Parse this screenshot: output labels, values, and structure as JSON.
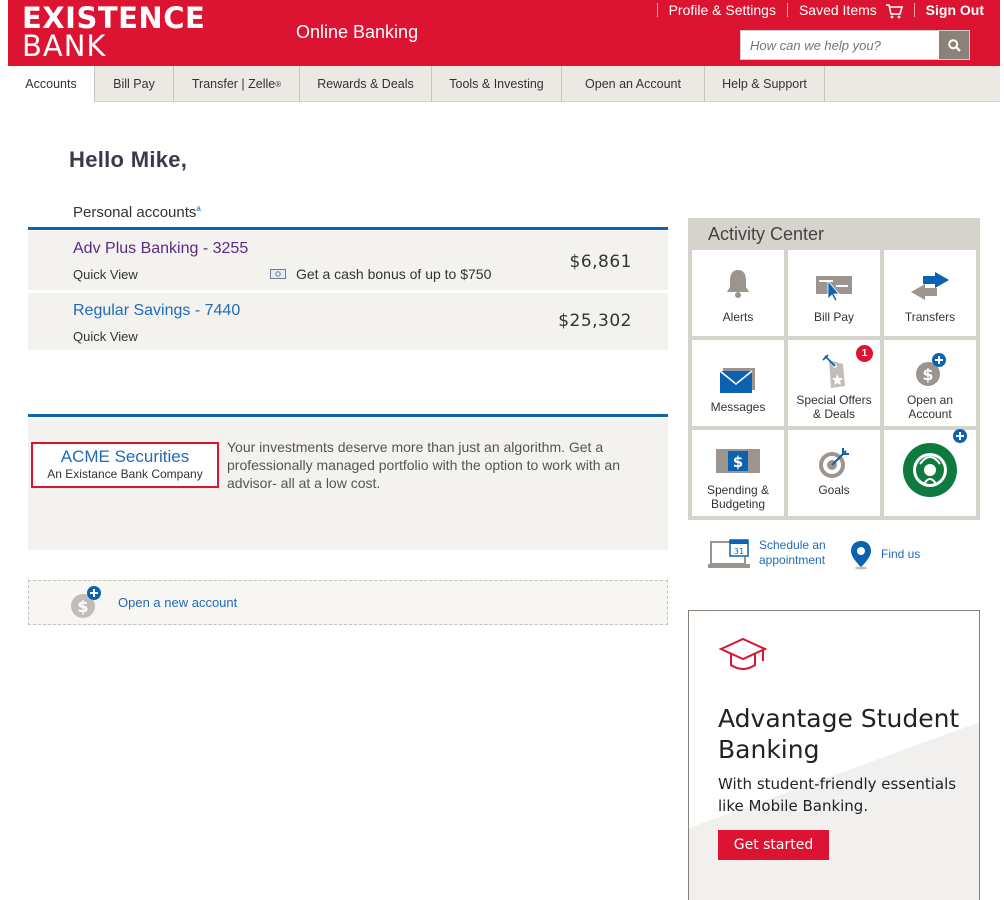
{
  "brand": {
    "line1": "EXISTENCE",
    "line2": "BANK",
    "section": "Online Banking"
  },
  "toplinks": {
    "profile": "Profile & Settings",
    "saved": "Saved Items",
    "signout": "Sign Out"
  },
  "search": {
    "placeholder": "How can we help you?"
  },
  "nav": {
    "tabs": [
      {
        "label": "Accounts"
      },
      {
        "label": "Bill Pay"
      },
      {
        "label": "Transfer | Zelle",
        "sup": "®"
      },
      {
        "label": "Rewards & Deals"
      },
      {
        "label": "Tools & Investing"
      },
      {
        "label": "Open an Account"
      },
      {
        "label": "Help & Support"
      }
    ]
  },
  "greeting": "Hello Mike,",
  "accounts": {
    "heading": "Personal accounts",
    "heading_sup": "a",
    "items": [
      {
        "name": "Adv Plus Banking - 3255",
        "quick_view": "Quick View",
        "balance": "$6,861",
        "promo": "Get a cash bonus of up to $750"
      },
      {
        "name": "Regular Savings - 7440",
        "quick_view": "Quick View",
        "balance": "$25,302"
      }
    ]
  },
  "securities": {
    "logo_title": "ACME Securities",
    "logo_sub": "An Existance Bank Company",
    "text": "Your investments deserve more than just an algorithm. Get a professionally managed portfolio with the option to work with an advisor- all at a low cost."
  },
  "open_new": {
    "label": "Open a new account"
  },
  "activity_center": {
    "title": "Activity Center",
    "tiles": [
      {
        "line1": "Alerts"
      },
      {
        "line1": "Bill Pay"
      },
      {
        "line1": "Transfers"
      },
      {
        "line1": "Messages"
      },
      {
        "line1": "Special Offers",
        "line2": "& Deals",
        "badge": "1"
      },
      {
        "line1": "Open an",
        "line2": "Account"
      },
      {
        "line1": "Spending &",
        "line2": "Budgeting"
      },
      {
        "line1": "Goals"
      }
    ]
  },
  "schedule": {
    "line1": "Schedule an",
    "line2": "appointment",
    "cal_day": "31"
  },
  "find_us": {
    "label": "Find us"
  },
  "ad": {
    "title1": "Advantage Student",
    "title2": "Banking",
    "sub1": "With student-friendly essentials",
    "sub2": "like Mobile Banking.",
    "cta": "Get started"
  },
  "colors": {
    "brand_red": "#dc1431",
    "link_blue": "#1f6bb7",
    "accent_blue": "#0a62b1",
    "panel_bg": "#f4f2ee"
  }
}
